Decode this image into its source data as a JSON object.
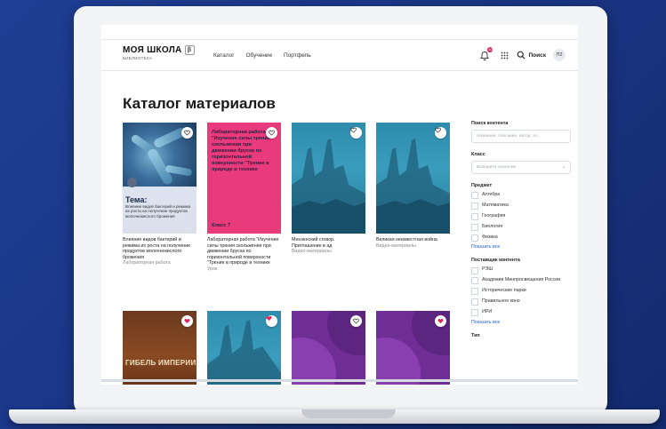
{
  "header": {
    "logo_title": "МОЯ ШКОЛА",
    "logo_badge": "β",
    "logo_sub": "БИБЛИОТЕКА",
    "nav": [
      "Каталог",
      "Обучение",
      "Портфель"
    ],
    "notifications": "10",
    "search_label": "Поиск",
    "avatar": "П2"
  },
  "page_title": "Каталог материалов",
  "cards": [
    {
      "title": "Влияние видов бактерий и режима их роста на получение продуктов молочнокислого брожения",
      "type": "Лабораторная работа",
      "favorite": false,
      "overlay_heading": "Тема:",
      "overlay_text": "Влияние видов бактерий и режима их роста на получение продуктов молочнокислого брожения"
    },
    {
      "title": "Лабораторная работа \"Изучение силы трения скольжения при движении бруска по горизонтальной поверхности \"Трение в природе и технике",
      "type": "Урок",
      "favorite": false,
      "cover_text": "Лабораторная работа \"Изучение силы трения скольжения при движении бруска по горизонтальной поверхности \"Трение в природе и технике",
      "cover_class": "Класс 7"
    },
    {
      "title": "Мензенский сговор. Приглашение в ад",
      "type": "Видео-материалы",
      "favorite": false
    },
    {
      "title": "Великая неизвестная война",
      "type": "Видео-материалы",
      "favorite": false
    },
    {
      "favorite": true,
      "cover_text": "ГИБЕЛЬ ИМПЕРИИ"
    },
    {
      "favorite": true
    },
    {
      "favorite": false
    },
    {
      "favorite": true
    }
  ],
  "sidebar": {
    "search_heading": "Поиск контента",
    "search_placeholder": "Название, описание, автор, те...",
    "class_heading": "Класс",
    "class_placeholder": "Выберите значение",
    "subject_heading": "Предмет",
    "subjects": [
      "Алгебра",
      "Математика",
      "География",
      "Биология",
      "Физика"
    ],
    "show_all": "Показать все",
    "provider_heading": "Поставщик контента",
    "providers": [
      "РЭШ",
      "Академия Минпросвещения России",
      "Исторические парки",
      "Правильное кино",
      "ИРИ"
    ],
    "show_all_2": "Показать все",
    "type_heading": "Тип"
  },
  "colors": {
    "accent": "#2962d6",
    "favorite": "#e0245e",
    "pink_cover": "#e93a7c",
    "purple_cover": "#6e2e95"
  }
}
